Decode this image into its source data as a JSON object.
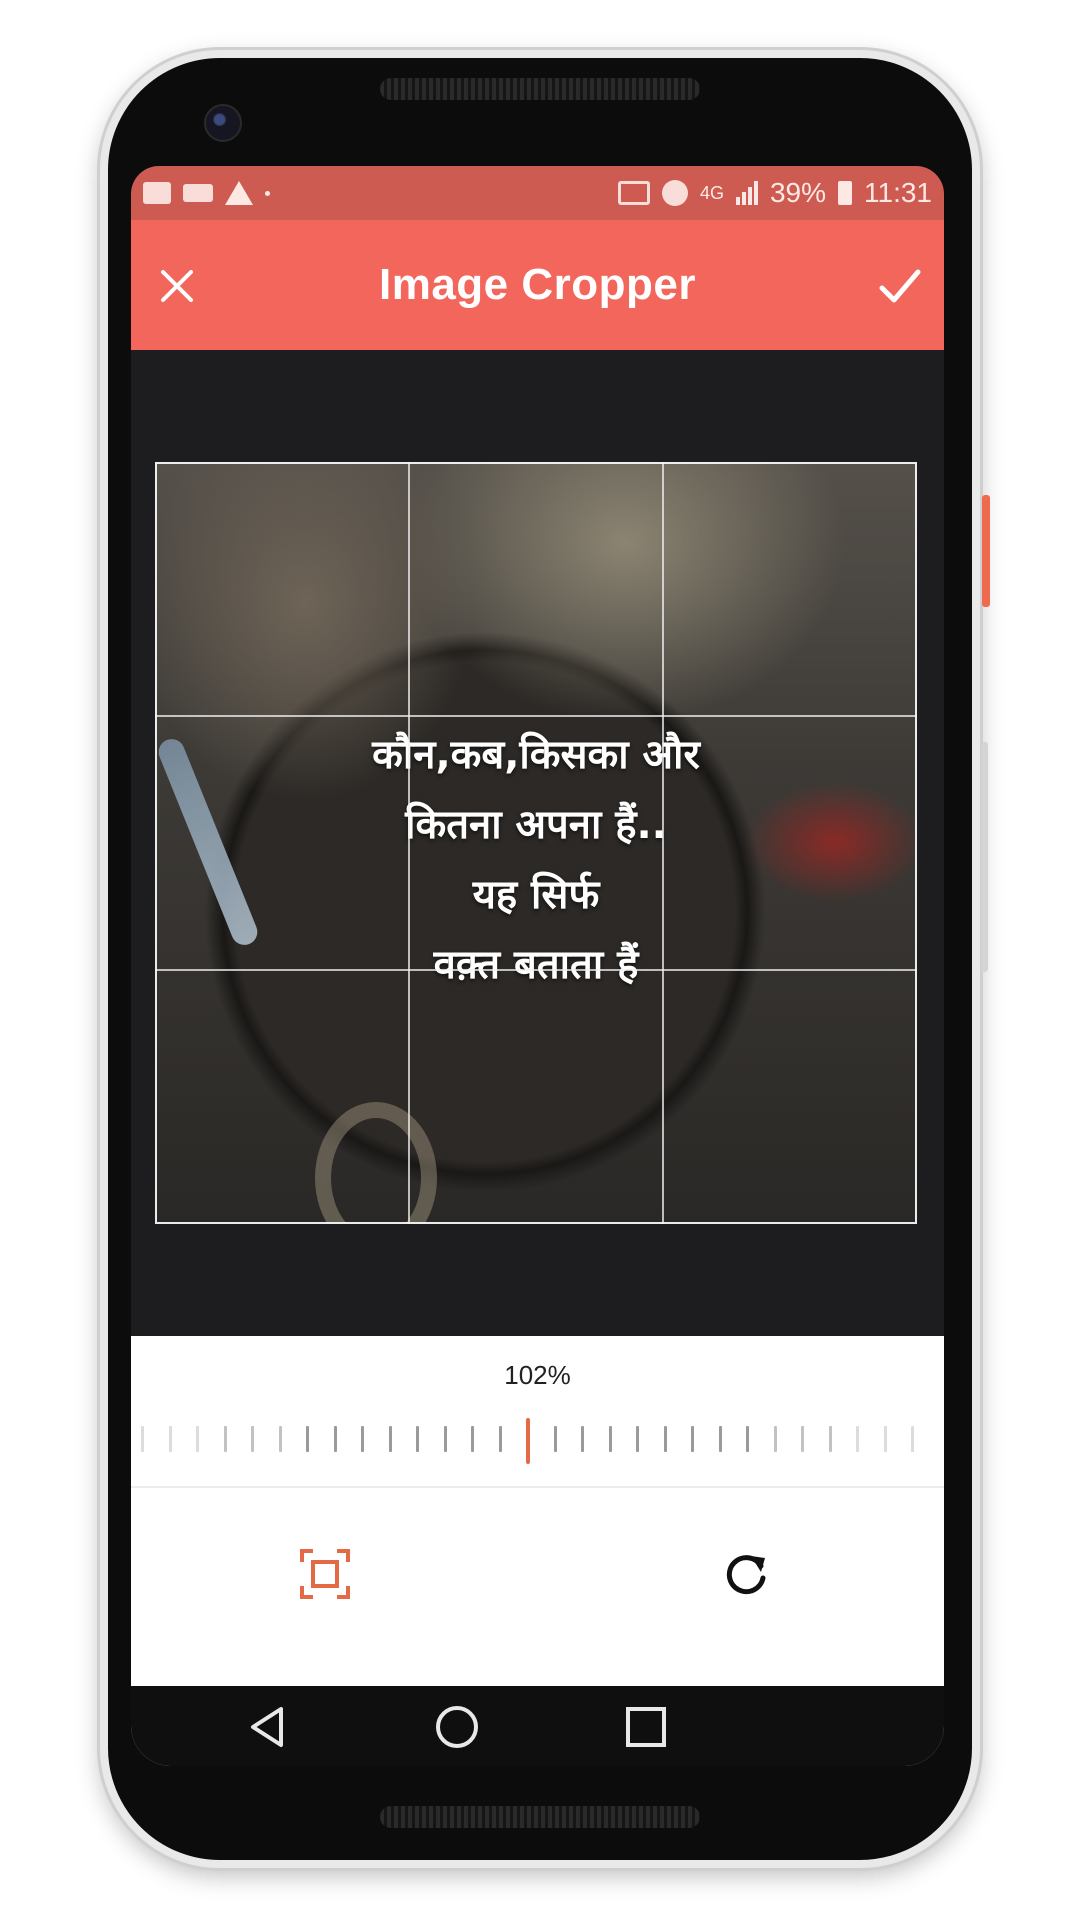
{
  "status_bar": {
    "battery_percent": "39%",
    "time": "11:31",
    "network": "4G",
    "icons": [
      "gallery-icon",
      "video-camera-icon",
      "warning-icon",
      "cast-icon",
      "alarm-icon",
      "signal-icon",
      "battery-icon"
    ]
  },
  "app_bar": {
    "title": "Image Cropper",
    "close_icon": "close-icon",
    "confirm_icon": "check-icon",
    "color": "#f2665b"
  },
  "image": {
    "quote_lines": [
      "कौन,कब,किसका और",
      "कितना अपना हैं..",
      "यह सिर्फ",
      "वक़्त बताता हैं"
    ]
  },
  "controls": {
    "zoom_label": "102%",
    "zoom_value": 102,
    "buttons": [
      "crop-frame-icon",
      "rotate-icon"
    ],
    "accent": "#e36a45"
  },
  "navigation": {
    "buttons": [
      "back-icon",
      "home-icon",
      "recents-icon"
    ]
  }
}
